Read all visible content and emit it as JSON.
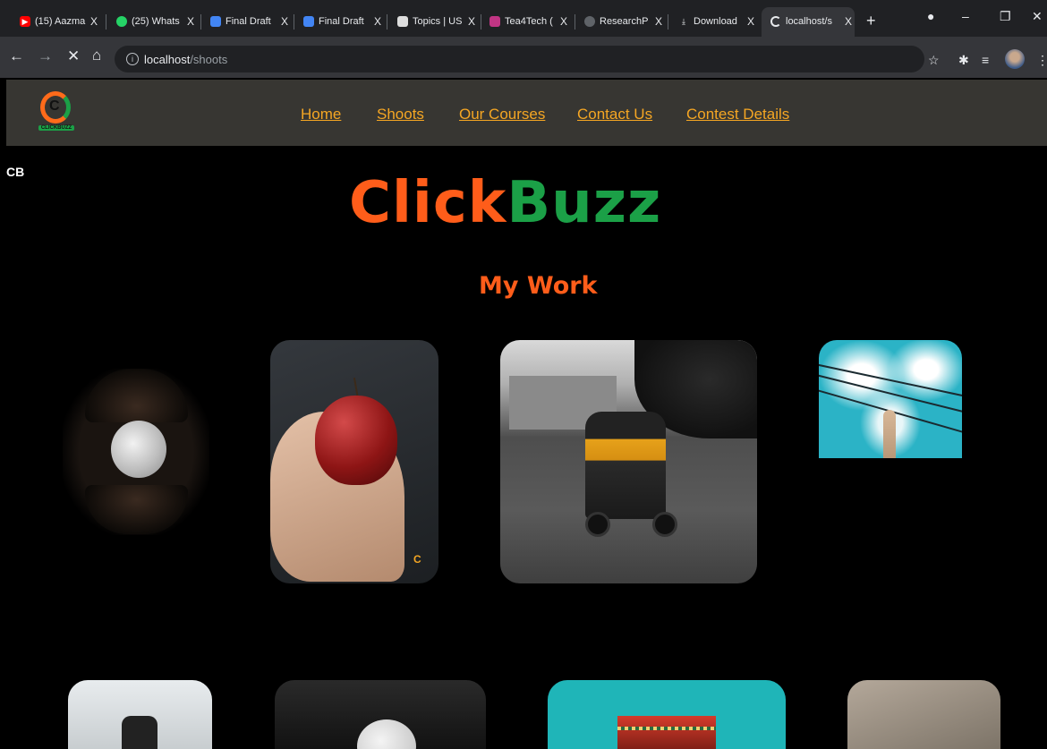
{
  "browser": {
    "tabs": [
      {
        "title": "(15) Aazma",
        "favicon": "youtube-icon",
        "color": "#ff0000"
      },
      {
        "title": "(25) Whats",
        "favicon": "whatsapp-icon",
        "color": "#25d366"
      },
      {
        "title": "Final Draft",
        "favicon": "docs-icon",
        "color": "#4285f4"
      },
      {
        "title": "Final Draft",
        "favicon": "docs-icon",
        "color": "#4285f4"
      },
      {
        "title": "Topics | US",
        "favicon": "panda-icon",
        "color": "#dddddd"
      },
      {
        "title": "Tea4Tech (",
        "favicon": "instagram-icon",
        "color": "#c13584"
      },
      {
        "title": "ResearchP",
        "favicon": "globe-icon",
        "color": "#9aa0a6"
      },
      {
        "title": "Download",
        "favicon": "download-icon",
        "color": "#e8eaed"
      },
      {
        "title": "localhost/s",
        "favicon": "loading-icon",
        "color": "#e8eaed",
        "active": true
      }
    ],
    "new_tab_glyph": "+",
    "close_glyph": "X",
    "url_host": "localhost",
    "url_path": "/shoots"
  },
  "site": {
    "logo_letter": "C",
    "logo_caption": "CLICKBUZZ",
    "nav": [
      "Home",
      "Shoots",
      "Our Courses",
      "Contact Us",
      "Contest Details"
    ],
    "corner_text": "CB",
    "brand_part1": "Click",
    "brand_part2": "Buzz",
    "section_title": "My Work",
    "watermark": "C",
    "colors": {
      "orange": "#ff5d1a",
      "green": "#1ba047",
      "link": "#f5a623",
      "header_bg": "#373632"
    }
  }
}
